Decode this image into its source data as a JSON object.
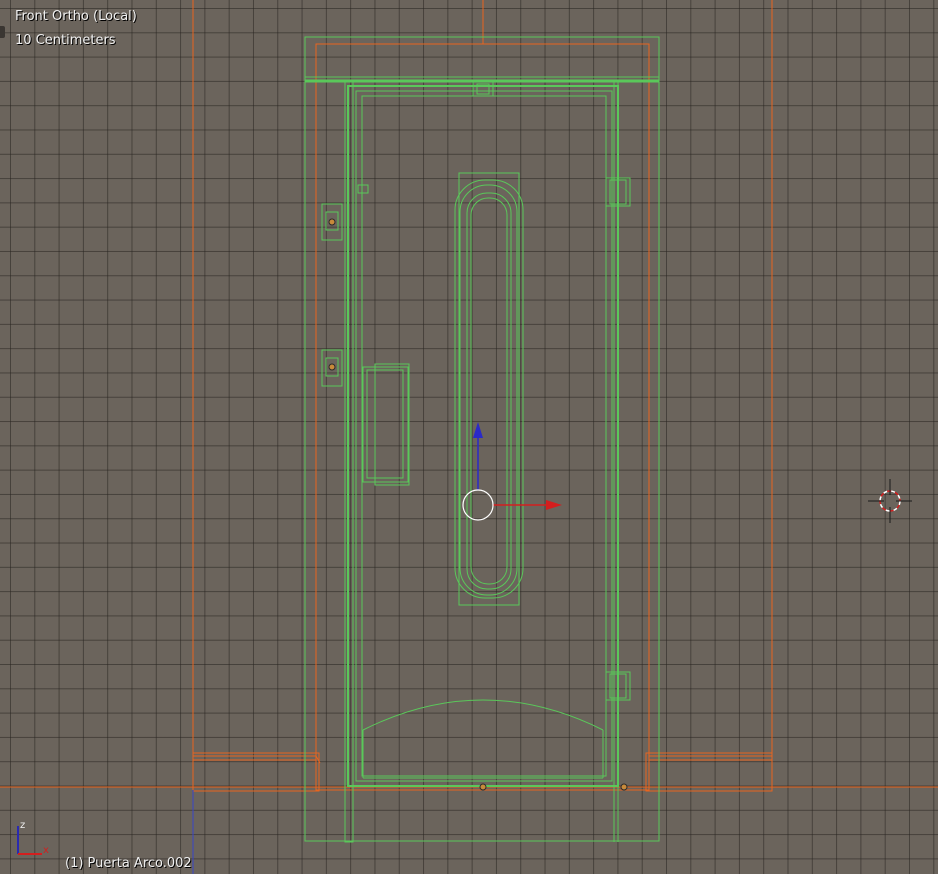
{
  "viewport": {
    "view_name": "Front Ortho (Local)",
    "grid_scale": "10 Centimeters",
    "active_object": "(1) Puerta Arco.002",
    "axis_labels": {
      "z": "z",
      "x": "x"
    }
  },
  "colors": {
    "background": "#6b645c",
    "grid": "#4e4842",
    "selected_wire": "#5ac85a",
    "orange_wire": "#e8651e",
    "x_axis": "#d41e1e",
    "z_axis": "#2a2aa0"
  },
  "icons": [
    "3d-cursor-icon",
    "manipulator-z-arrow-icon",
    "manipulator-x-arrow-icon",
    "manipulator-center-circle-icon",
    "axis-orientation-icon"
  ]
}
